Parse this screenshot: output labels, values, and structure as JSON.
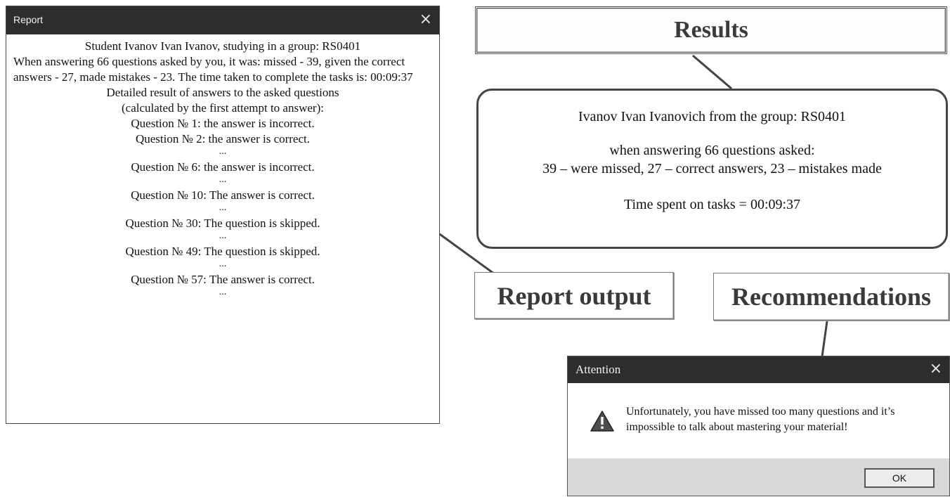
{
  "report_window": {
    "title": "Report",
    "close_glyph": "×",
    "header_line": "Student Ivanov Ivan Ivanov, studying in a group: RS0401",
    "summary_text": "When answering 66 questions asked by you, it was: missed - 39, given the correct answers - 27, made mistakes - 23. The time taken to complete the tasks is: 00:09:37",
    "detail_title": "Detailed result of answers to the asked questions",
    "detail_subtitle": "(calculated by the first attempt to answer):",
    "questions": [
      "Question № 1: the answer is incorrect.",
      "Question № 2: the answer is correct.",
      "Question № 6: the answer is incorrect.",
      "Question № 10: The answer is correct.",
      "Question № 30: The question is skipped.",
      "Question № 49: The question is skipped.",
      "Question № 57: The answer is correct."
    ],
    "ellipsis": "..."
  },
  "results": {
    "label": "Results"
  },
  "summary": {
    "line1": "Ivanov Ivan Ivanovich from the group: RS0401",
    "line2": "when answering 66 questions asked:",
    "line3": "39 – were missed, 27 – correct answers, 23 – mistakes made",
    "line4": "Time spent on tasks = 00:09:37"
  },
  "buttons": {
    "report_output": "Report output",
    "recommendations": "Recommendations"
  },
  "attention_dialog": {
    "title": "Attention",
    "close_glyph": "×",
    "icon": "warning-icon",
    "message": "Unfortunately, you have missed too many questions and it’s impossible to talk about mastering your material!",
    "ok_label": "OK"
  }
}
